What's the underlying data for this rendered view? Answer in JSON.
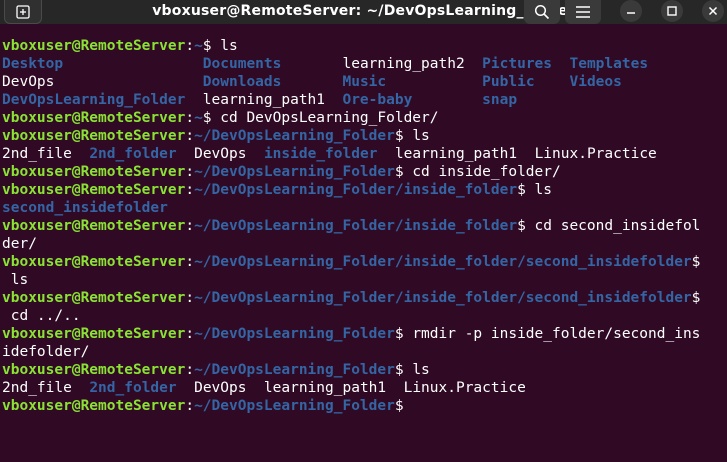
{
  "window": {
    "title": "vboxuser@RemoteServer: ~/DevOpsLearning_Folder"
  },
  "colors": {
    "background": "#300a24",
    "titlebar": "#272727",
    "user_host": "#8ae234",
    "path_and_dirs": "#3465a4",
    "text": "#ffffff"
  },
  "icons": {
    "new_tab": "new-tab-icon",
    "search": "search-icon",
    "menu": "hamburger-menu-icon",
    "minimize": "minimize-icon",
    "maximize": "maximize-icon",
    "close": "close-icon"
  },
  "terminal": {
    "prompt_user": "vboxuser@RemoteServer",
    "lines": [
      [
        {
          "t": "u",
          "v": "vboxuser@RemoteServer"
        },
        {
          "t": "w",
          "v": ":"
        },
        {
          "t": "p",
          "v": "~"
        },
        {
          "t": "w",
          "v": "$ ls"
        }
      ],
      [
        {
          "t": "d",
          "v": "Desktop"
        },
        {
          "t": "w",
          "v": "                "
        },
        {
          "t": "d",
          "v": "Documents"
        },
        {
          "t": "w",
          "v": "       learning_path2  "
        },
        {
          "t": "d",
          "v": "Pictures"
        },
        {
          "t": "w",
          "v": "  "
        },
        {
          "t": "d",
          "v": "Templates"
        }
      ],
      [
        {
          "t": "w",
          "v": "DevOps                 "
        },
        {
          "t": "d",
          "v": "Downloads"
        },
        {
          "t": "w",
          "v": "       "
        },
        {
          "t": "d",
          "v": "Music"
        },
        {
          "t": "w",
          "v": "           "
        },
        {
          "t": "d",
          "v": "Public"
        },
        {
          "t": "w",
          "v": "    "
        },
        {
          "t": "d",
          "v": "Videos"
        }
      ],
      [
        {
          "t": "d",
          "v": "DevOpsLearning_Folder"
        },
        {
          "t": "w",
          "v": "  learning_path1  "
        },
        {
          "t": "d",
          "v": "Ore-baby"
        },
        {
          "t": "w",
          "v": "        "
        },
        {
          "t": "d",
          "v": "snap"
        }
      ],
      [
        {
          "t": "u",
          "v": "vboxuser@RemoteServer"
        },
        {
          "t": "w",
          "v": ":"
        },
        {
          "t": "p",
          "v": "~"
        },
        {
          "t": "w",
          "v": "$ cd DevOpsLearning_Folder/"
        }
      ],
      [
        {
          "t": "u",
          "v": "vboxuser@RemoteServer"
        },
        {
          "t": "w",
          "v": ":"
        },
        {
          "t": "p",
          "v": "~/DevOpsLearning_Folder"
        },
        {
          "t": "w",
          "v": "$ ls"
        }
      ],
      [
        {
          "t": "w",
          "v": "2nd_file  "
        },
        {
          "t": "d",
          "v": "2nd_folder"
        },
        {
          "t": "w",
          "v": "  DevOps  "
        },
        {
          "t": "d",
          "v": "inside_folder"
        },
        {
          "t": "w",
          "v": "  learning_path1  Linux.Practice"
        }
      ],
      [
        {
          "t": "u",
          "v": "vboxuser@RemoteServer"
        },
        {
          "t": "w",
          "v": ":"
        },
        {
          "t": "p",
          "v": "~/DevOpsLearning_Folder"
        },
        {
          "t": "w",
          "v": "$ cd inside_folder/"
        }
      ],
      [
        {
          "t": "u",
          "v": "vboxuser@RemoteServer"
        },
        {
          "t": "w",
          "v": ":"
        },
        {
          "t": "p",
          "v": "~/DevOpsLearning_Folder/inside_folder"
        },
        {
          "t": "w",
          "v": "$ ls"
        }
      ],
      [
        {
          "t": "d",
          "v": "second_insidefolder"
        }
      ],
      [
        {
          "t": "u",
          "v": "vboxuser@RemoteServer"
        },
        {
          "t": "w",
          "v": ":"
        },
        {
          "t": "p",
          "v": "~/DevOpsLearning_Folder/inside_folder"
        },
        {
          "t": "w",
          "v": "$ cd second_insidefol"
        }
      ],
      [
        {
          "t": "w",
          "v": "der/"
        }
      ],
      [
        {
          "t": "u",
          "v": "vboxuser@RemoteServer"
        },
        {
          "t": "w",
          "v": ":"
        },
        {
          "t": "p",
          "v": "~/DevOpsLearning_Folder/inside_folder/second_insidefolder"
        },
        {
          "t": "w",
          "v": "$"
        }
      ],
      [
        {
          "t": "w",
          "v": " ls"
        }
      ],
      [
        {
          "t": "u",
          "v": "vboxuser@RemoteServer"
        },
        {
          "t": "w",
          "v": ":"
        },
        {
          "t": "p",
          "v": "~/DevOpsLearning_Folder/inside_folder/second_insidefolder"
        },
        {
          "t": "w",
          "v": "$"
        }
      ],
      [
        {
          "t": "w",
          "v": " cd ../.."
        }
      ],
      [
        {
          "t": "u",
          "v": "vboxuser@RemoteServer"
        },
        {
          "t": "w",
          "v": ":"
        },
        {
          "t": "p",
          "v": "~/DevOpsLearning_Folder"
        },
        {
          "t": "w",
          "v": "$ rmdir -p inside_folder/second_ins"
        }
      ],
      [
        {
          "t": "w",
          "v": "idefolder/"
        }
      ],
      [
        {
          "t": "u",
          "v": "vboxuser@RemoteServer"
        },
        {
          "t": "w",
          "v": ":"
        },
        {
          "t": "p",
          "v": "~/DevOpsLearning_Folder"
        },
        {
          "t": "w",
          "v": "$ ls"
        }
      ],
      [
        {
          "t": "w",
          "v": "2nd_file  "
        },
        {
          "t": "d",
          "v": "2nd_folder"
        },
        {
          "t": "w",
          "v": "  DevOps  learning_path1  Linux.Practice"
        }
      ],
      [
        {
          "t": "u",
          "v": "vboxuser@RemoteServer"
        },
        {
          "t": "w",
          "v": ":"
        },
        {
          "t": "p",
          "v": "~/DevOpsLearning_Folder"
        },
        {
          "t": "w",
          "v": "$ "
        }
      ]
    ]
  }
}
